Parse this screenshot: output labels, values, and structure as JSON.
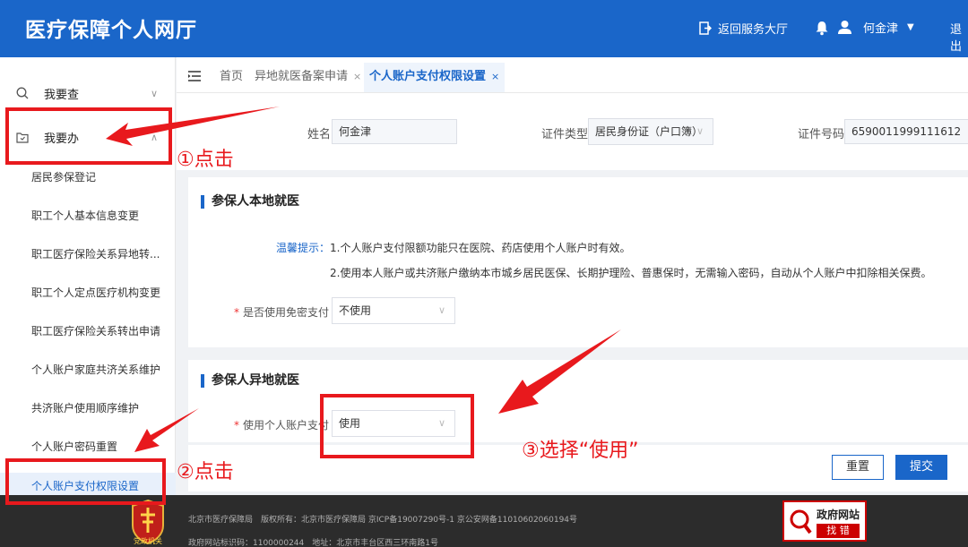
{
  "header": {
    "title": "医疗保障个人网厅",
    "back_label": "返回服务大厅",
    "user_name": "何金津",
    "logout_label": "退出",
    "bg_color": "#1a66c9"
  },
  "sidebar": {
    "groups": [
      {
        "label": "我要查",
        "icon": "search-icon",
        "chevron": "∨"
      },
      {
        "label": "我要办",
        "icon": "folder-icon",
        "chevron": "∧"
      }
    ],
    "items": [
      {
        "label": "居民参保登记"
      },
      {
        "label": "职工个人基本信息变更"
      },
      {
        "label": "职工医疗保险关系异地转..."
      },
      {
        "label": "职工个人定点医疗机构变更"
      },
      {
        "label": "职工医疗保险关系转出申请"
      },
      {
        "label": "个人账户家庭共济关系维护"
      },
      {
        "label": "共济账户使用顺序维护"
      },
      {
        "label": "个人账户密码重置"
      },
      {
        "label": "个人账户支付权限设置",
        "active": true
      }
    ]
  },
  "tabs": [
    {
      "label": "首页"
    },
    {
      "label": "异地就医备案申请",
      "close": "×"
    },
    {
      "label": "个人账户支付权限设置",
      "close": "×",
      "active": true
    }
  ],
  "form": {
    "name_label": "姓名",
    "name_value": "何金津",
    "idtype_label": "证件类型",
    "idtype_value": "居民身份证（户口簿）",
    "idno_label": "证件号码",
    "idno_value": "6590011999111612"
  },
  "local": {
    "title": "参保人本地就医",
    "tip_label": "温馨提示：",
    "tip1": "1.个人账户支付限额功能只在医院、药店使用个人账户时有效。",
    "tip2": "2.使用本人账户或共济账户缴纳本市城乡居民医保、长期护理险、普惠保时，无需输入密码，自动从个人账户中扣除相关保费。",
    "field_label": "是否使用免密支付",
    "field_value": "不使用",
    "required_mark": "*"
  },
  "remote": {
    "title": "参保人异地就医",
    "field_label": "使用个人账户支付",
    "field_value": "使用",
    "required_mark": "*"
  },
  "buttons": {
    "reset": "重置",
    "submit": "提交"
  },
  "footer": {
    "line1": "北京市医疗保障局　版权所有：北京市医疗保障局 京ICP备19007290号-1 京公安网备11010602060194号",
    "line2": "政府网站标识码：1100000244　地址：北京市丰台区西三环南路1号",
    "emblem_text": "党政机关",
    "badge_title": "政府网站",
    "badge_sub": "找 错"
  },
  "annotations": {
    "step1": "①点击",
    "step2": "②点击",
    "step3": "③选择“使用”",
    "color": "#e8191d"
  }
}
